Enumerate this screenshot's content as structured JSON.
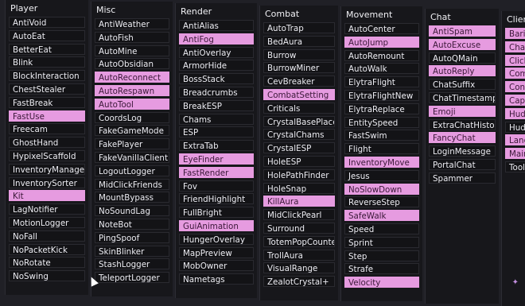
{
  "panels": [
    {
      "title": "Player",
      "items": [
        {
          "label": "AntiVoid",
          "on": false
        },
        {
          "label": "AutoEat",
          "on": false
        },
        {
          "label": "BetterEat",
          "on": false
        },
        {
          "label": "Blink",
          "on": false
        },
        {
          "label": "BlockInteraction",
          "on": false
        },
        {
          "label": "ChestStealer",
          "on": false
        },
        {
          "label": "FastBreak",
          "on": false
        },
        {
          "label": "FastUse",
          "on": true
        },
        {
          "label": "Freecam",
          "on": false
        },
        {
          "label": "GhostHand",
          "on": false
        },
        {
          "label": "HypixelScaffold",
          "on": false
        },
        {
          "label": "InventoryManager",
          "on": false
        },
        {
          "label": "InventorySorter",
          "on": false
        },
        {
          "label": "Kit",
          "on": true
        },
        {
          "label": "LagNotifier",
          "on": false
        },
        {
          "label": "MotionLogger",
          "on": false
        },
        {
          "label": "NoFall",
          "on": false
        },
        {
          "label": "NoPacketKick",
          "on": false
        },
        {
          "label": "NoRotate",
          "on": false
        },
        {
          "label": "NoSwing",
          "on": false
        }
      ]
    },
    {
      "title": "Misc",
      "items": [
        {
          "label": "AntiWeather",
          "on": false
        },
        {
          "label": "AutoFish",
          "on": false
        },
        {
          "label": "AutoMine",
          "on": false
        },
        {
          "label": "AutoObsidian",
          "on": false
        },
        {
          "label": "AutoReconnect",
          "on": true
        },
        {
          "label": "AutoRespawn",
          "on": true
        },
        {
          "label": "AutoTool",
          "on": true
        },
        {
          "label": "CoordsLog",
          "on": false
        },
        {
          "label": "FakeGameMode",
          "on": false
        },
        {
          "label": "FakePlayer",
          "on": false
        },
        {
          "label": "FakeVanillaClient",
          "on": false
        },
        {
          "label": "LogoutLogger",
          "on": false
        },
        {
          "label": "MidClickFriends",
          "on": false
        },
        {
          "label": "MountBypass",
          "on": false
        },
        {
          "label": "NoSoundLag",
          "on": false
        },
        {
          "label": "NoteBot",
          "on": false
        },
        {
          "label": "PingSpoof",
          "on": false
        },
        {
          "label": "SkinBlinker",
          "on": false
        },
        {
          "label": "StashLogger",
          "on": false
        },
        {
          "label": "TeleportLogger",
          "on": false
        }
      ]
    },
    {
      "title": "Render",
      "items": [
        {
          "label": "AntiAlias",
          "on": false
        },
        {
          "label": "AntiFog",
          "on": true
        },
        {
          "label": "AntiOverlay",
          "on": false
        },
        {
          "label": "ArmorHide",
          "on": false
        },
        {
          "label": "BossStack",
          "on": false
        },
        {
          "label": "Breadcrumbs",
          "on": false
        },
        {
          "label": "BreakESP",
          "on": false
        },
        {
          "label": "Chams",
          "on": false
        },
        {
          "label": "ESP",
          "on": false
        },
        {
          "label": "ExtraTab",
          "on": false
        },
        {
          "label": "EyeFinder",
          "on": true
        },
        {
          "label": "FastRender",
          "on": true
        },
        {
          "label": "Fov",
          "on": false
        },
        {
          "label": "FriendHighlight",
          "on": false
        },
        {
          "label": "FullBright",
          "on": false
        },
        {
          "label": "GuiAnimation",
          "on": true
        },
        {
          "label": "HungerOverlay",
          "on": false
        },
        {
          "label": "MapPreview",
          "on": false
        },
        {
          "label": "MobOwner",
          "on": false
        },
        {
          "label": "Nametags",
          "on": false
        }
      ]
    },
    {
      "title": "Combat",
      "items": [
        {
          "label": "AutoTrap",
          "on": false
        },
        {
          "label": "BedAura",
          "on": false
        },
        {
          "label": "Burrow",
          "on": false
        },
        {
          "label": "BurrowMiner",
          "on": false
        },
        {
          "label": "CevBreaker",
          "on": false
        },
        {
          "label": "CombatSetting",
          "on": true
        },
        {
          "label": "Criticals",
          "on": false
        },
        {
          "label": "CrystalBasePlace",
          "on": false
        },
        {
          "label": "CrystalChams",
          "on": false
        },
        {
          "label": "CrystalESP",
          "on": false
        },
        {
          "label": "HoleESP",
          "on": false
        },
        {
          "label": "HolePathFinder",
          "on": false
        },
        {
          "label": "HoleSnap",
          "on": false
        },
        {
          "label": "KillAura",
          "on": true
        },
        {
          "label": "MidClickPearl",
          "on": false
        },
        {
          "label": "Surround",
          "on": false
        },
        {
          "label": "TotemPopCounter",
          "on": false
        },
        {
          "label": "TrollAura",
          "on": false
        },
        {
          "label": "VisualRange",
          "on": false
        },
        {
          "label": "ZealotCrystal+",
          "on": false
        }
      ]
    },
    {
      "title": "Movement",
      "items": [
        {
          "label": "AutoCenter",
          "on": false
        },
        {
          "label": "AutoJump",
          "on": true
        },
        {
          "label": "AutoRemount",
          "on": false
        },
        {
          "label": "AutoWalk",
          "on": false
        },
        {
          "label": "ElytraFlight",
          "on": false
        },
        {
          "label": "ElytraFlightNew",
          "on": false
        },
        {
          "label": "ElytraReplace",
          "on": false
        },
        {
          "label": "EntitySpeed",
          "on": false
        },
        {
          "label": "FastSwim",
          "on": false
        },
        {
          "label": "Flight",
          "on": false
        },
        {
          "label": "InventoryMove",
          "on": true
        },
        {
          "label": "Jesus",
          "on": false
        },
        {
          "label": "NoSlowDown",
          "on": true
        },
        {
          "label": "ReverseStep",
          "on": false
        },
        {
          "label": "SafeWalk",
          "on": true
        },
        {
          "label": "Speed",
          "on": false
        },
        {
          "label": "Sprint",
          "on": false
        },
        {
          "label": "Step",
          "on": false
        },
        {
          "label": "Strafe",
          "on": false
        },
        {
          "label": "Velocity",
          "on": true
        }
      ]
    },
    {
      "title": "Chat",
      "items": [
        {
          "label": "AntiSpam",
          "on": true
        },
        {
          "label": "AutoExcuse",
          "on": true
        },
        {
          "label": "AutoQMain",
          "on": false
        },
        {
          "label": "AutoReply",
          "on": true
        },
        {
          "label": "ChatSuffix",
          "on": false
        },
        {
          "label": "ChatTimestamp",
          "on": false
        },
        {
          "label": "Emoji",
          "on": true
        },
        {
          "label": "ExtraChatHistory",
          "on": false
        },
        {
          "label": "FancyChat",
          "on": true
        },
        {
          "label": "LoginMessage",
          "on": false
        },
        {
          "label": "PortalChat",
          "on": false
        },
        {
          "label": "Spammer",
          "on": false
        }
      ]
    },
    {
      "title": "Client",
      "items": [
        {
          "label": "Baritone",
          "on": true
        },
        {
          "label": "ChatS",
          "on": true
        },
        {
          "label": "Clickgui",
          "on": true
        },
        {
          "label": "Commands",
          "on": true
        },
        {
          "label": "Configuration",
          "on": true
        },
        {
          "label": "Capes",
          "on": true
        },
        {
          "label": "Hud",
          "on": true
        },
        {
          "label": "HudEditor",
          "on": false
        },
        {
          "label": "Language",
          "on": true
        },
        {
          "label": "MainMenu",
          "on": true
        },
        {
          "label": "Tooltips",
          "on": false
        }
      ]
    }
  ],
  "icons": {
    "cursor": "mouse-cursor-icon",
    "corner": "sparkle-icon"
  },
  "colors": {
    "enabled": "#e69be0",
    "background": "#17171b"
  }
}
